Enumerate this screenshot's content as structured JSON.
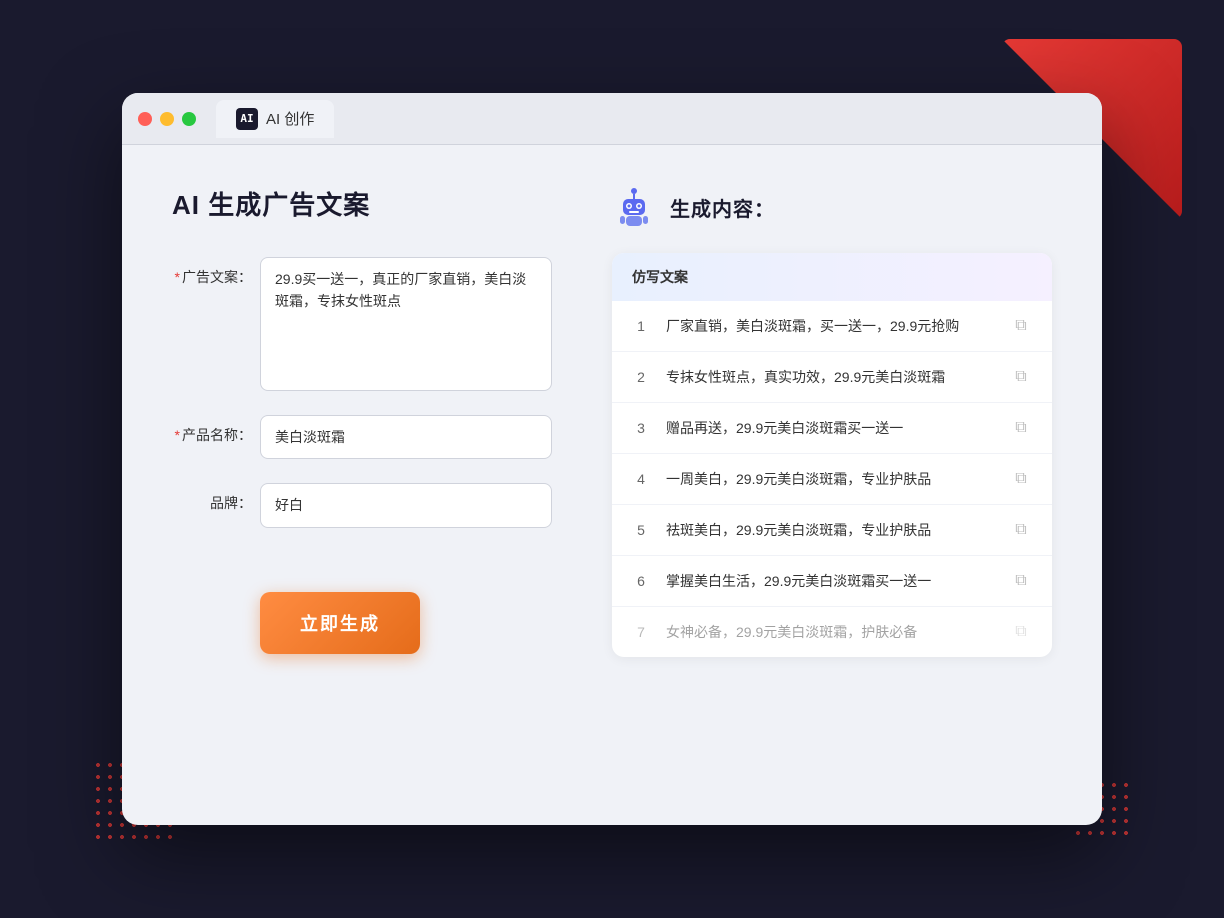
{
  "window": {
    "tab_label": "AI 创作",
    "tab_icon": "AI"
  },
  "left": {
    "page_title": "AI 生成广告文案",
    "fields": [
      {
        "label": "广告文案：",
        "required": true,
        "type": "textarea",
        "value": "29.9买一送一，真正的厂家直销，美白淡斑霜，专抹女性斑点",
        "name": "ad-copy-input"
      },
      {
        "label": "产品名称：",
        "required": true,
        "type": "input",
        "value": "美白淡斑霜",
        "name": "product-name-input"
      },
      {
        "label": "品牌：",
        "required": false,
        "type": "input",
        "value": "好白",
        "name": "brand-input"
      }
    ],
    "generate_button": "立即生成"
  },
  "right": {
    "header_title": "生成内容：",
    "table_header": "仿写文案",
    "results": [
      {
        "id": 1,
        "text": "厂家直销，美白淡斑霜，买一送一，29.9元抢购",
        "dimmed": false
      },
      {
        "id": 2,
        "text": "专抹女性斑点，真实功效，29.9元美白淡斑霜",
        "dimmed": false
      },
      {
        "id": 3,
        "text": "赠品再送，29.9元美白淡斑霜买一送一",
        "dimmed": false
      },
      {
        "id": 4,
        "text": "一周美白，29.9元美白淡斑霜，专业护肤品",
        "dimmed": false
      },
      {
        "id": 5,
        "text": "祛斑美白，29.9元美白淡斑霜，专业护肤品",
        "dimmed": false
      },
      {
        "id": 6,
        "text": "掌握美白生活，29.9元美白淡斑霜买一送一",
        "dimmed": false
      },
      {
        "id": 7,
        "text": "女神必备，29.9元美白淡斑霜，护肤必备",
        "dimmed": true
      }
    ]
  }
}
